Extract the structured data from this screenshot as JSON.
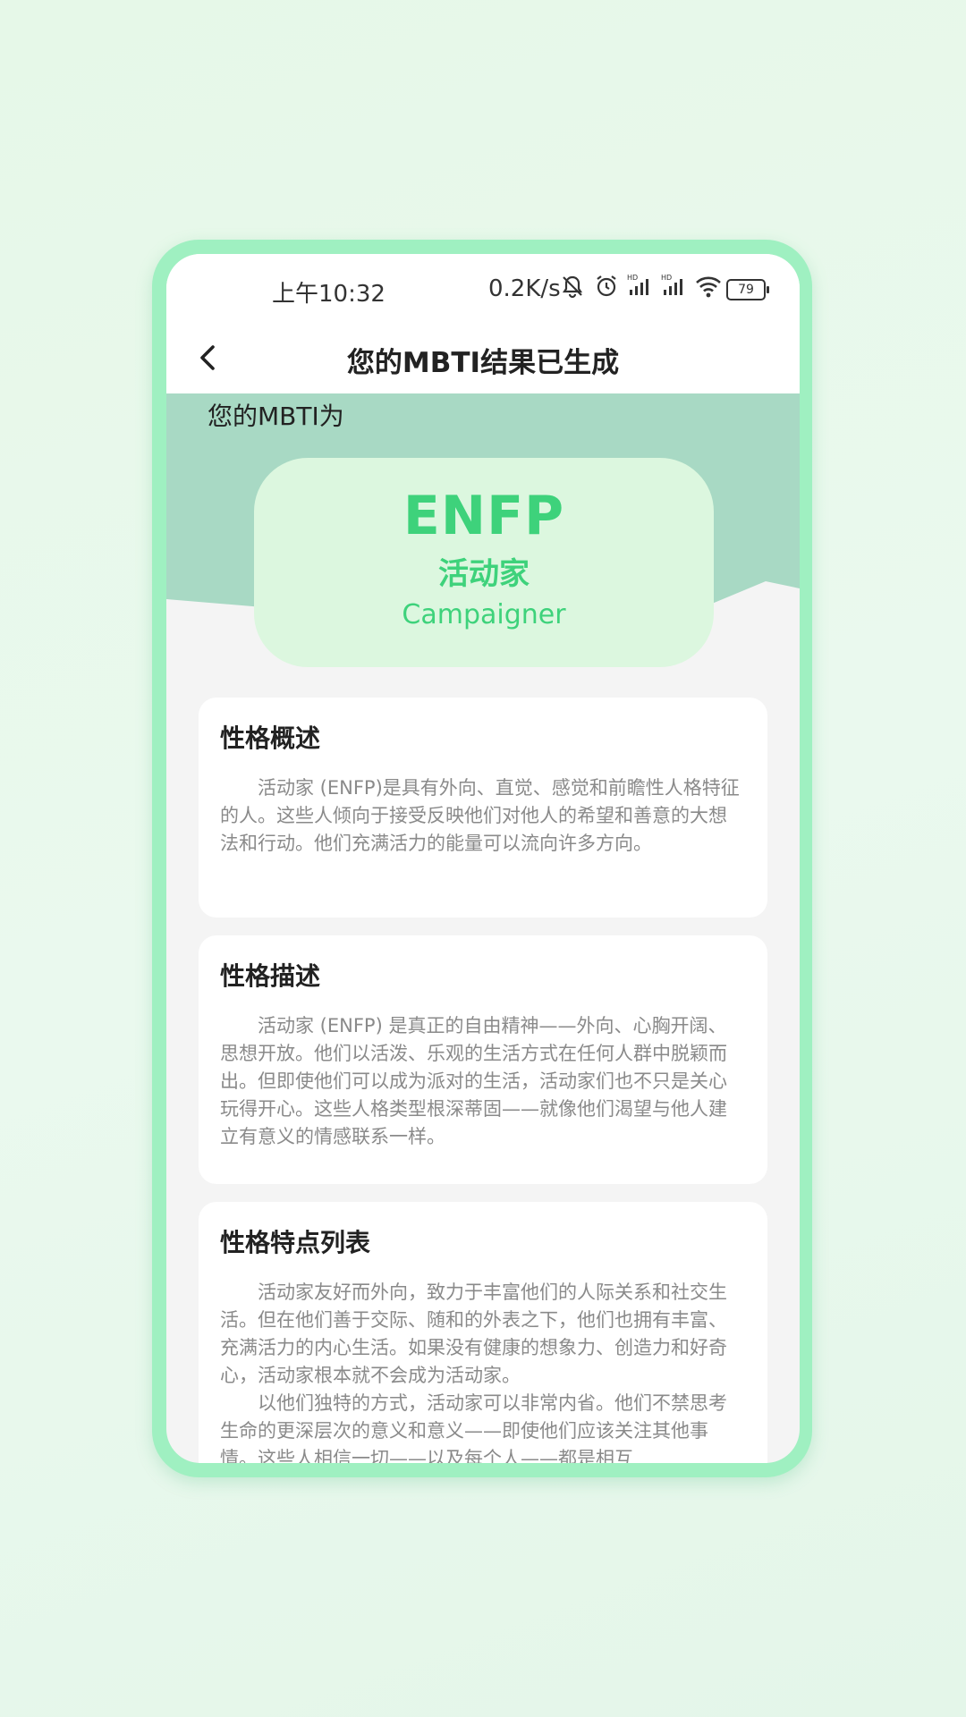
{
  "status_bar": {
    "time": "上午10:32",
    "speed": "0.2K/s",
    "battery": "79",
    "icons": [
      "bell-off-icon",
      "alarm-icon",
      "signal-hd-icon",
      "signal-hd-icon",
      "wifi-icon",
      "battery-icon"
    ]
  },
  "nav": {
    "title": "您的MBTI结果已生成",
    "back_icon": "chevron-left-icon"
  },
  "result": {
    "label": "您的MBTI为",
    "code": "ENFP",
    "name_cn": "活动家",
    "name_en": "Campaigner"
  },
  "sections": [
    {
      "title": "性格概述",
      "paragraphs": [
        "活动家 (ENFP)是具有外向、直觉、感觉和前瞻性人格特征的人。这些人倾向于接受反映他们对他人的希望和善意的大想法和行动。他们充满活力的能量可以流向许多方向。"
      ]
    },
    {
      "title": "性格描述",
      "paragraphs": [
        "活动家 (ENFP) 是真正的自由精神——外向、心胸开阔、思想开放。他们以活泼、乐观的生活方式在任何人群中脱颖而出。但即使他们可以成为派对的生活，活动家们也不只是关心玩得开心。这些人格类型根深蒂固——就像他们渴望与他人建立有意义的情感联系一样。"
      ]
    },
    {
      "title": "性格特点列表",
      "paragraphs": [
        "活动家友好而外向，致力于丰富他们的人际关系和社交生活。但在他们善于交际、随和的外表之下，他们也拥有丰富、充满活力的内心生活。如果没有健康的想象力、创造力和好奇心，活动家根本就不会成为活动家。",
        "以他们独特的方式，活动家可以非常内省。他们不禁思考生命的更深层次的意义和意义——即使他们应该关注其他事情。这些人相信一切——以及每个人——都是相互"
      ]
    }
  ],
  "colors": {
    "accent": "#3ed27b",
    "hero_bg": "#a8d9c4",
    "card_bg": "#dcf7df",
    "frame": "#9ff0c1"
  }
}
